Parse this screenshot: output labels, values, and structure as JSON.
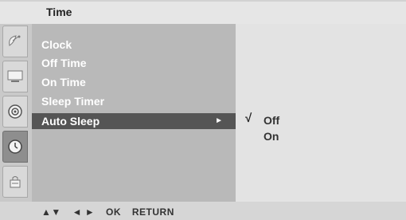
{
  "window": {
    "title": "Time"
  },
  "menu": {
    "items": [
      {
        "label": "Clock"
      },
      {
        "label": "Off Time"
      },
      {
        "label": "On Time"
      },
      {
        "label": "Sleep Timer"
      },
      {
        "label": "Auto Sleep",
        "selected": true,
        "arrow": "►"
      }
    ]
  },
  "options": {
    "check_mark": "√",
    "items": [
      {
        "label": "Off",
        "checked": true
      },
      {
        "label": "On",
        "checked": false
      }
    ]
  },
  "rail": {
    "icons": [
      "satellite-dish-icon",
      "screen-icon",
      "speaker-icon",
      "clock-icon",
      "lock-icon"
    ],
    "active_index": 3
  },
  "footer": {
    "up_down": "▲▼",
    "left_right": "◄ ►",
    "ok": "OK",
    "return": "RETURN"
  },
  "colors": {
    "main_panel": "#b9b9b9",
    "selected_row": "#555555",
    "right_panel": "#e3e3e3"
  }
}
